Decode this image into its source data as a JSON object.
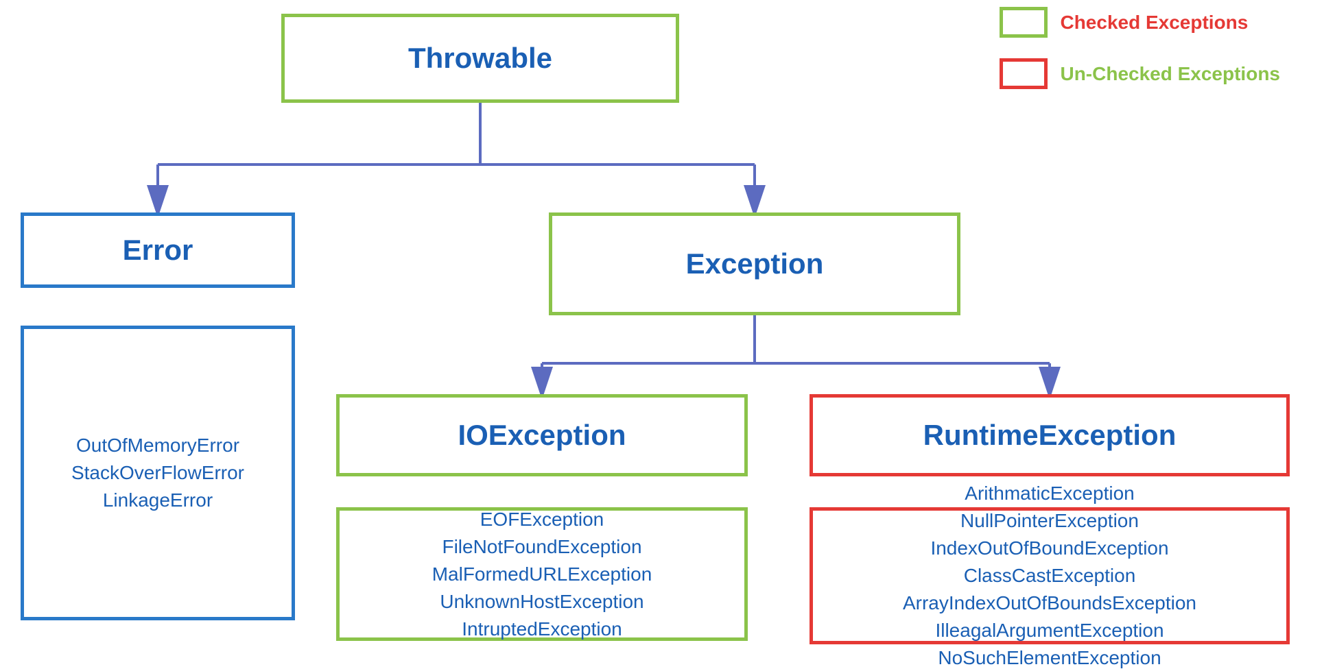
{
  "legend": {
    "checked": {
      "label": "Checked Exceptions"
    },
    "unchecked": {
      "label": "Un-Checked Exceptions"
    }
  },
  "nodes": {
    "throwable": {
      "label": "Throwable"
    },
    "error": {
      "label": "Error"
    },
    "exception": {
      "label": "Exception"
    },
    "ioexception": {
      "label": "IOException"
    },
    "runtimeexception": {
      "label": "RuntimeException"
    }
  },
  "subitems": {
    "error": [
      "OutOfMemoryError",
      "StackOverFlowError",
      "LinkageError"
    ],
    "ioexception": [
      "EOFException",
      "FileNotFoundException",
      "MalFormedURLException",
      "UnknownHostException",
      "IntruptedException"
    ],
    "runtimeexception": [
      "ArithmaticException",
      "NullPointerException",
      "IndexOutOfBoundException",
      "ClassCastException",
      "ArrayIndexOutOfBoundsException",
      "IlleagalArgumentException",
      "NoSuchElementException"
    ]
  }
}
